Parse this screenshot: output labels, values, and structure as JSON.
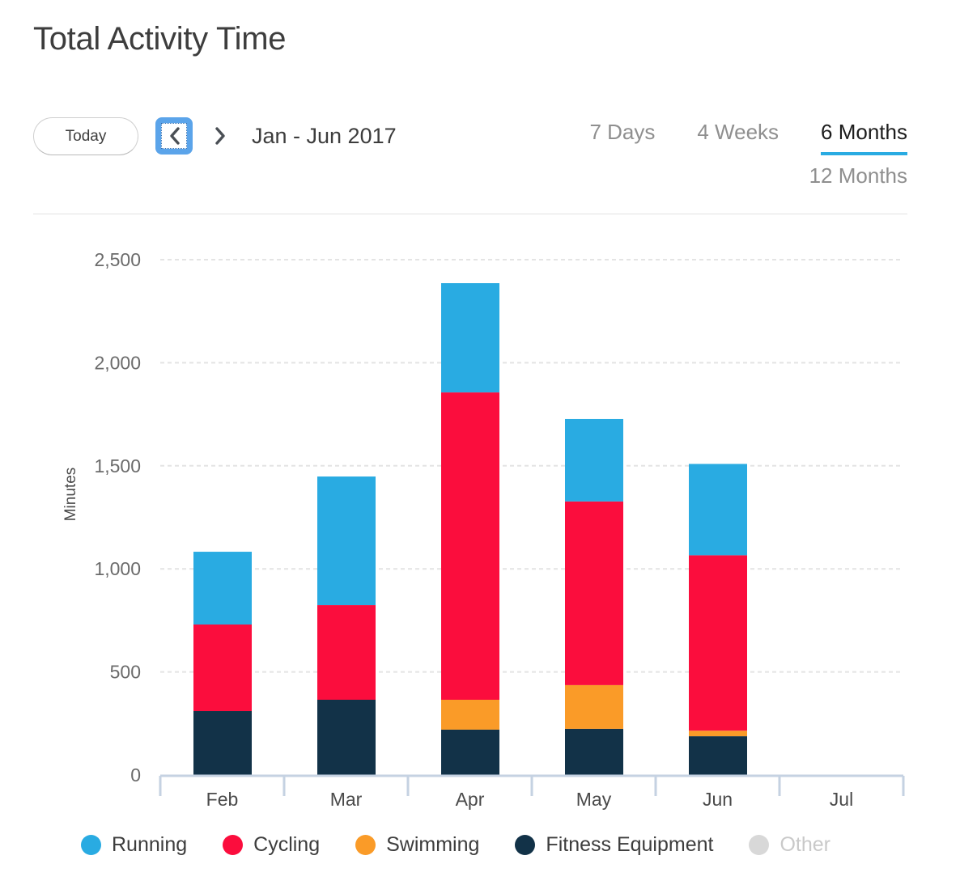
{
  "header": {
    "title": "Total Activity Time"
  },
  "toolbar": {
    "today_label": "Today",
    "prev_icon": "chevron-left-icon",
    "next_icon": "chevron-right-icon",
    "date_range": "Jan - Jun 2017",
    "tabs": [
      {
        "label": "7 Days",
        "active": false
      },
      {
        "label": "4 Weeks",
        "active": false
      },
      {
        "label": "6 Months",
        "active": true
      },
      {
        "label": "12 Months",
        "active": false
      }
    ]
  },
  "colors": {
    "running": "#29ABE2",
    "cycling": "#FB0D3D",
    "swimming": "#FA9B28",
    "fitness_equipment": "#123248",
    "other": "#D8D8D8",
    "accent": "#29ABE2",
    "focus_ring": "#5BA4EA",
    "gridline": "#E4E4E4",
    "axis": "#C5D2E2"
  },
  "legend": [
    {
      "label": "Running",
      "color": "#29ABE2",
      "disabled": false
    },
    {
      "label": "Cycling",
      "color": "#FB0D3D",
      "disabled": false
    },
    {
      "label": "Swimming",
      "color": "#FA9B28",
      "disabled": false
    },
    {
      "label": "Fitness Equipment",
      "color": "#123248",
      "disabled": false
    },
    {
      "label": "Other",
      "color": "#D8D8D8",
      "disabled": true
    }
  ],
  "chart_data": {
    "type": "bar",
    "stacked": true,
    "title": "Total Activity Time",
    "xlabel": "",
    "ylabel": "Minutes",
    "categories": [
      "Feb",
      "Mar",
      "Apr",
      "May",
      "Jun",
      "Jul"
    ],
    "ylim": [
      0,
      2500
    ],
    "yticks": [
      0,
      500,
      1000,
      1500,
      2000,
      2500
    ],
    "ytick_labels": [
      "0",
      "500",
      "1,000",
      "1,500",
      "2,000",
      "2,500"
    ],
    "grid": true,
    "legend_position": "bottom",
    "series": [
      {
        "name": "Fitness Equipment",
        "color": "#123248",
        "values": [
          310,
          365,
          220,
          224,
          188,
          0
        ]
      },
      {
        "name": "Swimming",
        "color": "#FA9B28",
        "values": [
          0,
          0,
          145,
          212,
          27,
          0
        ]
      },
      {
        "name": "Cycling",
        "color": "#FB0D3D",
        "values": [
          420,
          459,
          1491,
          891,
          851,
          0
        ]
      },
      {
        "name": "Running",
        "color": "#29ABE2",
        "values": [
          353,
          624,
          530,
          400,
          443,
          0
        ]
      },
      {
        "name": "Other",
        "color": "#D8D8D8",
        "values": [
          0,
          0,
          0,
          0,
          0,
          0
        ]
      }
    ],
    "totals": [
      1083,
      1448,
      2386,
      1726,
      1510,
      0
    ]
  }
}
